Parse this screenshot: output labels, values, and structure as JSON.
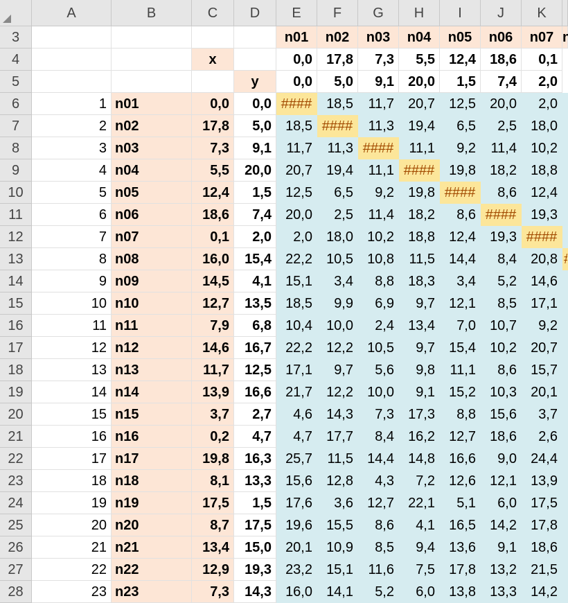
{
  "columns": [
    "A",
    "B",
    "C",
    "D",
    "E",
    "F",
    "G",
    "H",
    "I",
    "J",
    "K"
  ],
  "row_numbers": [
    3,
    4,
    5,
    6,
    7,
    8,
    9,
    10,
    11,
    12,
    13,
    14,
    15,
    16,
    17,
    18,
    19,
    20,
    21,
    22,
    23,
    24,
    25,
    26,
    27,
    28
  ],
  "labels": {
    "x": "x",
    "y": "y"
  },
  "col_headers_names": [
    "n01",
    "n02",
    "n03",
    "n04",
    "n05",
    "n06",
    "n07"
  ],
  "header_x_values": [
    "0,0",
    "17,8",
    "7,3",
    "5,5",
    "12,4",
    "18,6",
    "0,1"
  ],
  "header_y_values": [
    "0,0",
    "5,0",
    "9,1",
    "20,0",
    "1,5",
    "7,4",
    "2,0"
  ],
  "overflow_glyph": "####",
  "colors": {
    "peach": "#fde6d6",
    "blue": "#d6ecf0",
    "yellow": "#fce69a",
    "header": "#e6e6e6"
  },
  "rows": [
    {
      "idx": "1",
      "name": "n01",
      "x": "0,0",
      "y": "0,0",
      "d": [
        "####",
        "18,5",
        "11,7",
        "20,7",
        "12,5",
        "20,0",
        "2,0"
      ]
    },
    {
      "idx": "2",
      "name": "n02",
      "x": "17,8",
      "y": "5,0",
      "d": [
        "18,5",
        "####",
        "11,3",
        "19,4",
        "6,5",
        "2,5",
        "18,0"
      ]
    },
    {
      "idx": "3",
      "name": "n03",
      "x": "7,3",
      "y": "9,1",
      "d": [
        "11,7",
        "11,3",
        "####",
        "11,1",
        "9,2",
        "11,4",
        "10,2"
      ]
    },
    {
      "idx": "4",
      "name": "n04",
      "x": "5,5",
      "y": "20,0",
      "d": [
        "20,7",
        "19,4",
        "11,1",
        "####",
        "19,8",
        "18,2",
        "18,8"
      ]
    },
    {
      "idx": "5",
      "name": "n05",
      "x": "12,4",
      "y": "1,5",
      "d": [
        "12,5",
        "6,5",
        "9,2",
        "19,8",
        "####",
        "8,6",
        "12,4"
      ]
    },
    {
      "idx": "6",
      "name": "n06",
      "x": "18,6",
      "y": "7,4",
      "d": [
        "20,0",
        "2,5",
        "11,4",
        "18,2",
        "8,6",
        "####",
        "19,3"
      ]
    },
    {
      "idx": "7",
      "name": "n07",
      "x": "0,1",
      "y": "2,0",
      "d": [
        "2,0",
        "18,0",
        "10,2",
        "18,8",
        "12,4",
        "19,3",
        "####"
      ]
    },
    {
      "idx": "8",
      "name": "n08",
      "x": "16,0",
      "y": "15,4",
      "d": [
        "22,2",
        "10,5",
        "10,8",
        "11,5",
        "14,4",
        "8,4",
        "20,8"
      ]
    },
    {
      "idx": "9",
      "name": "n09",
      "x": "14,5",
      "y": "4,1",
      "d": [
        "15,1",
        "3,4",
        "8,8",
        "18,3",
        "3,4",
        "5,2",
        "14,6"
      ]
    },
    {
      "idx": "10",
      "name": "n10",
      "x": "12,7",
      "y": "13,5",
      "d": [
        "18,5",
        "9,9",
        "6,9",
        "9,7",
        "12,1",
        "8,5",
        "17,1"
      ]
    },
    {
      "idx": "11",
      "name": "n11",
      "x": "7,9",
      "y": "6,8",
      "d": [
        "10,4",
        "10,0",
        "2,4",
        "13,4",
        "7,0",
        "10,7",
        "9,2"
      ]
    },
    {
      "idx": "12",
      "name": "n12",
      "x": "14,6",
      "y": "16,7",
      "d": [
        "22,2",
        "12,2",
        "10,5",
        "9,7",
        "15,4",
        "10,2",
        "20,7"
      ]
    },
    {
      "idx": "13",
      "name": "n13",
      "x": "11,7",
      "y": "12,5",
      "d": [
        "17,1",
        "9,7",
        "5,6",
        "9,8",
        "11,1",
        "8,6",
        "15,7"
      ]
    },
    {
      "idx": "14",
      "name": "n14",
      "x": "13,9",
      "y": "16,6",
      "d": [
        "21,7",
        "12,2",
        "10,0",
        "9,1",
        "15,2",
        "10,3",
        "20,1"
      ]
    },
    {
      "idx": "15",
      "name": "n15",
      "x": "3,7",
      "y": "2,7",
      "d": [
        "4,6",
        "14,3",
        "7,3",
        "17,3",
        "8,8",
        "15,6",
        "3,7"
      ]
    },
    {
      "idx": "16",
      "name": "n16",
      "x": "0,2",
      "y": "4,7",
      "d": [
        "4,7",
        "17,7",
        "8,4",
        "16,2",
        "12,7",
        "18,6",
        "2,6"
      ]
    },
    {
      "idx": "17",
      "name": "n17",
      "x": "19,8",
      "y": "16,3",
      "d": [
        "25,7",
        "11,5",
        "14,4",
        "14,8",
        "16,6",
        "9,0",
        "24,4"
      ]
    },
    {
      "idx": "18",
      "name": "n18",
      "x": "8,1",
      "y": "13,3",
      "d": [
        "15,6",
        "12,8",
        "4,3",
        "7,2",
        "12,6",
        "12,1",
        "13,9"
      ]
    },
    {
      "idx": "19",
      "name": "n19",
      "x": "17,5",
      "y": "1,5",
      "d": [
        "17,6",
        "3,6",
        "12,7",
        "22,1",
        "5,1",
        "6,0",
        "17,5"
      ]
    },
    {
      "idx": "20",
      "name": "n20",
      "x": "8,7",
      "y": "17,5",
      "d": [
        "19,6",
        "15,5",
        "8,6",
        "4,1",
        "16,5",
        "14,2",
        "17,8"
      ]
    },
    {
      "idx": "21",
      "name": "n21",
      "x": "13,4",
      "y": "15,0",
      "d": [
        "20,1",
        "10,9",
        "8,5",
        "9,4",
        "13,6",
        "9,1",
        "18,6"
      ]
    },
    {
      "idx": "22",
      "name": "n22",
      "x": "12,9",
      "y": "19,3",
      "d": [
        "23,2",
        "15,1",
        "11,6",
        "7,5",
        "17,8",
        "13,2",
        "21,5"
      ]
    },
    {
      "idx": "23",
      "name": "n23",
      "x": "7,3",
      "y": "14,3",
      "d": [
        "16,0",
        "14,1",
        "5,2",
        "6,0",
        "13,8",
        "13,3",
        "14,2"
      ]
    }
  ]
}
